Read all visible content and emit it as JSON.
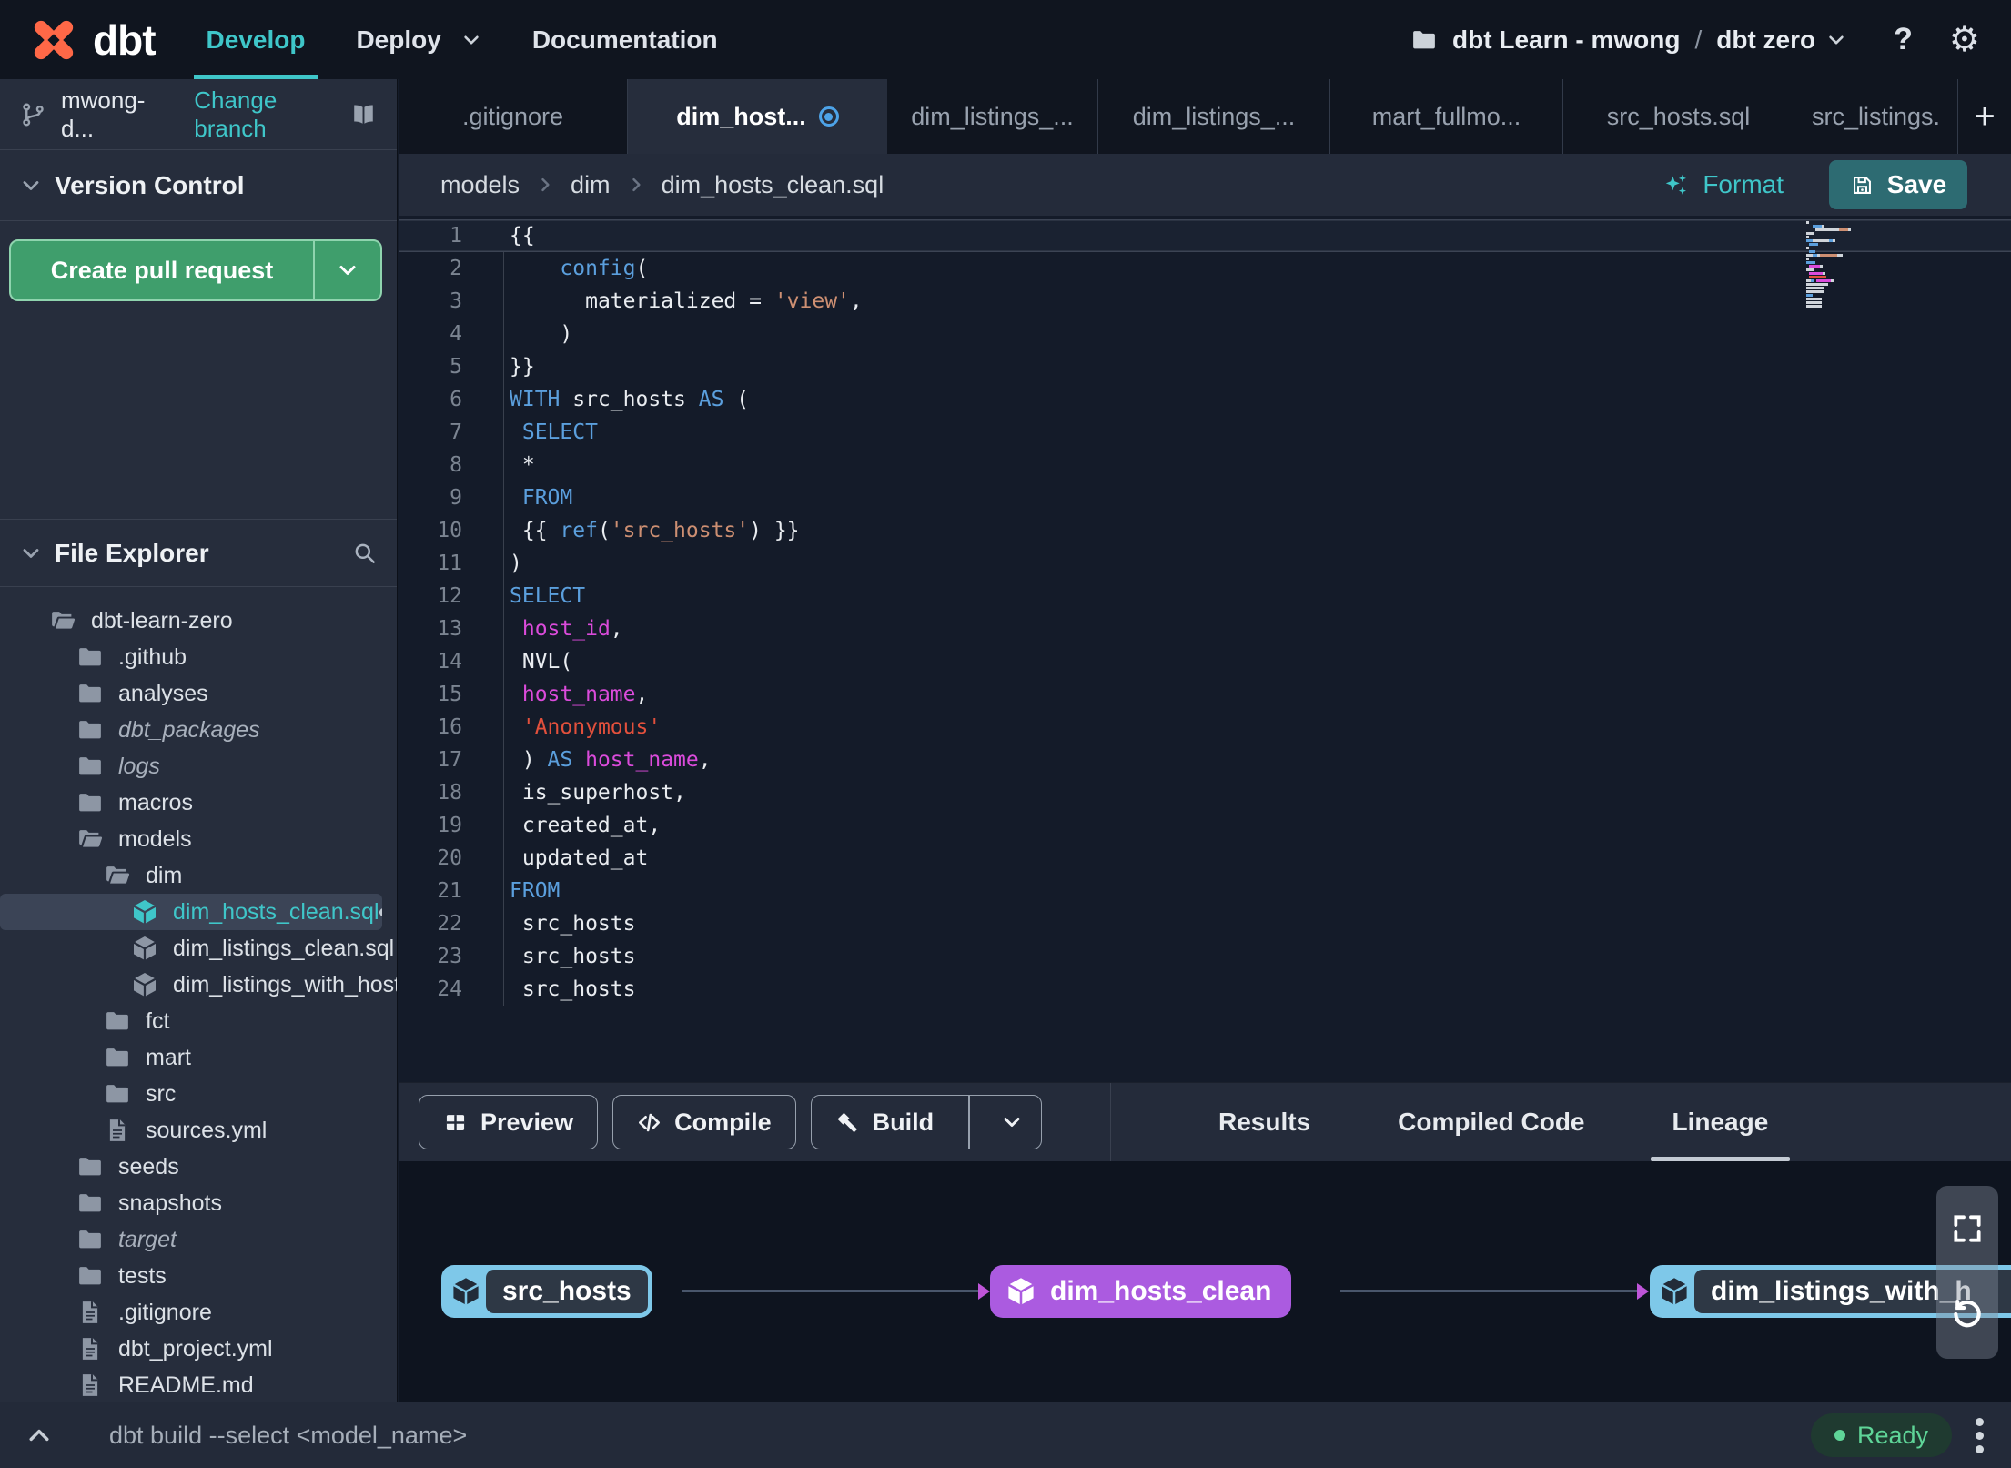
{
  "topnav": {
    "brand": "dbt",
    "items": [
      {
        "label": "Develop",
        "active": true
      },
      {
        "label": "Deploy",
        "has_caret": true
      },
      {
        "label": "Documentation"
      }
    ],
    "project": {
      "account": "dbt Learn - mwong",
      "separator": "/",
      "project_name": "dbt zero"
    }
  },
  "icons": {
    "help": "?",
    "settings": "⚙",
    "add_tab": "+"
  },
  "sidebar": {
    "branch": {
      "name": "mwong-d...",
      "action": "Change branch"
    },
    "version_control": {
      "title": "Version Control",
      "create_pr": "Create pull request"
    },
    "file_explorer": {
      "title": "File Explorer",
      "tree": [
        {
          "label": "dbt-learn-zero",
          "type": "folderOpen",
          "depth": 0
        },
        {
          "label": ".github",
          "type": "folder",
          "depth": 1
        },
        {
          "label": "analyses",
          "type": "folder",
          "depth": 1
        },
        {
          "label": "dbt_packages",
          "type": "folder",
          "depth": 1,
          "italic": true
        },
        {
          "label": "logs",
          "type": "folder",
          "depth": 1,
          "italic": true
        },
        {
          "label": "macros",
          "type": "folder",
          "depth": 1
        },
        {
          "label": "models",
          "type": "folderOpen",
          "depth": 1
        },
        {
          "label": "dim",
          "type": "folderOpen",
          "depth": 2
        },
        {
          "label": "dim_hosts_clean.sql",
          "type": "model",
          "depth": 3,
          "selected": true,
          "modified": true
        },
        {
          "label": "dim_listings_clean.sql",
          "type": "model",
          "depth": 3
        },
        {
          "label": "dim_listings_with_hosts...",
          "type": "model",
          "depth": 3
        },
        {
          "label": "fct",
          "type": "folder",
          "depth": 2
        },
        {
          "label": "mart",
          "type": "folder",
          "depth": 2
        },
        {
          "label": "src",
          "type": "folder",
          "depth": 2
        },
        {
          "label": "sources.yml",
          "type": "file",
          "depth": 2
        },
        {
          "label": "seeds",
          "type": "folder",
          "depth": 1
        },
        {
          "label": "snapshots",
          "type": "folder",
          "depth": 1
        },
        {
          "label": "target",
          "type": "folder",
          "depth": 1,
          "italic": true
        },
        {
          "label": "tests",
          "type": "folder",
          "depth": 1
        },
        {
          "label": ".gitignore",
          "type": "file",
          "depth": 1
        },
        {
          "label": "dbt_project.yml",
          "type": "file",
          "depth": 1
        },
        {
          "label": "README.md",
          "type": "file",
          "depth": 1
        }
      ]
    }
  },
  "tabs": {
    "items": [
      {
        "label": ".gitignore"
      },
      {
        "label": "dim_host...",
        "active": true,
        "modified": true
      },
      {
        "label": "dim_listings_..."
      },
      {
        "label": "dim_listings_..."
      },
      {
        "label": "mart_fullmo..."
      },
      {
        "label": "src_hosts.sql"
      },
      {
        "label": "src_listings."
      }
    ]
  },
  "editor": {
    "breadcrumb": [
      "models",
      "dim",
      "dim_hosts_clean.sql"
    ],
    "format_label": "Format",
    "save_label": "Save",
    "lines": [
      {
        "n": 1,
        "current": true,
        "segs": [
          [
            "{{",
            "pl"
          ]
        ]
      },
      {
        "n": 2,
        "segs": [
          [
            "    ",
            "pl"
          ],
          [
            "config",
            "kw"
          ],
          [
            "(",
            "pl"
          ]
        ]
      },
      {
        "n": 3,
        "segs": [
          [
            "      ",
            "pl"
          ],
          [
            "materialized = ",
            "pl"
          ],
          [
            "'view'",
            "str"
          ],
          [
            ",",
            "pl"
          ]
        ]
      },
      {
        "n": 4,
        "segs": [
          [
            "    )",
            "pl"
          ]
        ]
      },
      {
        "n": 5,
        "segs": [
          [
            "}}",
            "pl"
          ]
        ]
      },
      {
        "n": 6,
        "segs": [
          [
            "WITH",
            "kw"
          ],
          [
            " src_hosts ",
            "pl"
          ],
          [
            "AS",
            "kw"
          ],
          [
            " (",
            "pl"
          ]
        ]
      },
      {
        "n": 7,
        "segs": [
          [
            " ",
            "pl"
          ],
          [
            "SELECT",
            "kw"
          ]
        ]
      },
      {
        "n": 8,
        "segs": [
          [
            " *",
            "pl"
          ]
        ]
      },
      {
        "n": 9,
        "segs": [
          [
            " ",
            "pl"
          ],
          [
            "FROM",
            "kw"
          ]
        ]
      },
      {
        "n": 10,
        "segs": [
          [
            " {{ ",
            "pl"
          ],
          [
            "ref",
            "kw"
          ],
          [
            "(",
            "pl"
          ],
          [
            "'src_hosts'",
            "str"
          ],
          [
            ") }}",
            "pl"
          ]
        ]
      },
      {
        "n": 11,
        "segs": [
          [
            ")",
            "pl"
          ]
        ]
      },
      {
        "n": 12,
        "segs": [
          [
            "SELECT",
            "kw"
          ]
        ]
      },
      {
        "n": 13,
        "segs": [
          [
            " ",
            "pl"
          ],
          [
            "host_id",
            "id"
          ],
          [
            ",",
            "pl"
          ]
        ]
      },
      {
        "n": 14,
        "segs": [
          [
            " NVL(",
            "pl"
          ]
        ]
      },
      {
        "n": 15,
        "segs": [
          [
            " ",
            "pl"
          ],
          [
            "host_name",
            "id"
          ],
          [
            ",",
            "pl"
          ]
        ]
      },
      {
        "n": 16,
        "segs": [
          [
            " ",
            "pl"
          ],
          [
            "'Anonymous'",
            "strr"
          ]
        ]
      },
      {
        "n": 17,
        "segs": [
          [
            " ) ",
            "pl"
          ],
          [
            "AS",
            "kw"
          ],
          [
            " ",
            "pl"
          ],
          [
            "host_name",
            "id"
          ],
          [
            ",",
            "pl"
          ]
        ]
      },
      {
        "n": 18,
        "segs": [
          [
            " is_superhost,",
            "pl"
          ]
        ]
      },
      {
        "n": 19,
        "segs": [
          [
            " created_at,",
            "pl"
          ]
        ]
      },
      {
        "n": 20,
        "segs": [
          [
            " updated_at",
            "pl"
          ]
        ]
      },
      {
        "n": 21,
        "segs": [
          [
            "FROM",
            "kw"
          ]
        ]
      },
      {
        "n": 22,
        "segs": [
          [
            " src_hosts",
            "pl"
          ]
        ]
      },
      {
        "n": 23,
        "segs": [
          [
            " src_hosts",
            "pl"
          ]
        ]
      },
      {
        "n": 24,
        "segs": [
          [
            " src_hosts",
            "pl"
          ]
        ]
      }
    ]
  },
  "actionbar": {
    "preview": "Preview",
    "compile": "Compile",
    "build": "Build",
    "tabs": [
      {
        "label": "Results"
      },
      {
        "label": "Compiled Code"
      },
      {
        "label": "Lineage",
        "active": true
      }
    ]
  },
  "lineage": {
    "nodes": [
      {
        "label": "src_hosts",
        "style": "source",
        "color": "#7ec8e9"
      },
      {
        "label": "dim_hosts_clean",
        "style": "model-selected",
        "color": "#ab5be0"
      },
      {
        "label": "dim_listings_with_h",
        "style": "source",
        "color": "#7ec8e9"
      }
    ]
  },
  "statusbar": {
    "command": "dbt build --select <model_name>",
    "status": "Ready"
  }
}
